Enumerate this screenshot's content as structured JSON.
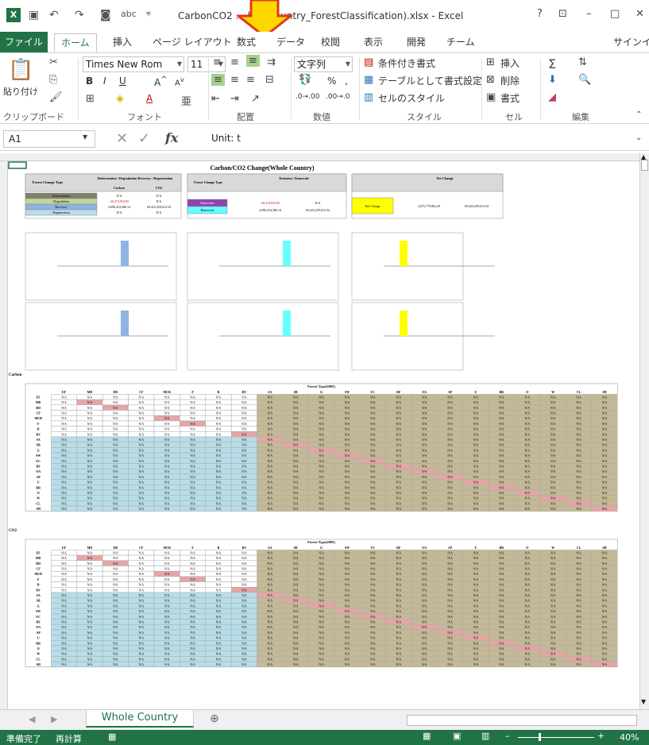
{
  "window": {
    "title": "CarbonCO2 ... holeCountry_ForestClassification).xlsx - Excel",
    "help": "?",
    "minimize": "–",
    "restore": "□",
    "close": "✕"
  },
  "tabs": [
    "ファイル",
    "ホーム",
    "挿入",
    "ページ レイアウト",
    "数式",
    "データ",
    "校閲",
    "表示",
    "開発",
    "チーム"
  ],
  "signin": "サインイ",
  "ribbon": {
    "paste": "貼り付け",
    "font_name": "Times New Rom",
    "font_size": "11",
    "number_format": "文字列",
    "cond_format": "条件付き書式",
    "table_format": "テーブルとして書式設定",
    "cell_style": "セルのスタイル",
    "insert": "挿入",
    "delete": "削除",
    "format": "書式",
    "groups": [
      "クリップボード",
      "フォント",
      "配置",
      "数値",
      "スタイル",
      "セル",
      "編集"
    ]
  },
  "formula": {
    "cell": "A1",
    "fx": "fx",
    "value": "Unit: t"
  },
  "sheet": {
    "title": "Carbon/CO2 Change(Whole Country)",
    "section_carbon": "Carbon",
    "section_co2": "CO2",
    "forest_type_header": "Forest Type(2005)",
    "table1": {
      "hdr_forest_change": "Forest Change Type",
      "hdr_def": "Deforestation / Degradation Recovery / Regeneration",
      "hdr_carbon": "Carbon",
      "hdr_co2": "CO2",
      "rows": [
        "Deforestation",
        "Degradation",
        "Recovery",
        "Regeneration"
      ],
      "carbon_vals": [
        "N/A",
        "-20,474,923.85",
        "2,696,254,386.14",
        "N/A"
      ],
      "co2_vals": [
        "N/A",
        "N/A",
        "69,423,259,613.54",
        "N/A"
      ]
    },
    "table2": {
      "hdr_change_type": "Forest Change Type",
      "hdr_em": "Emission / Removals",
      "emissions": "Emissions",
      "removals": "Removals",
      "em_carbon": "-20,474,923.85",
      "rem_carbon": "2,696,254,386.14",
      "em_co2": "N/A",
      "rem_co2": "69,423,259,613.54"
    },
    "table3": {
      "hdr": "Net Change",
      "net_change": "Net Change",
      "carbon": "2,675,779,862.29",
      "co2": "69,423,259,613.54"
    },
    "types": [
      "EF",
      "MD",
      "DD",
      "CF",
      "MCB",
      "F",
      "B",
      "RV",
      "SA",
      "SR",
      "G",
      "SW",
      "UC",
      "RF",
      "OA",
      "AP",
      "U",
      "BR",
      "O",
      "W",
      "CL",
      "SH"
    ],
    "na": "N/A"
  },
  "sheet_tab": "Whole Country",
  "status": {
    "ready": "準備完了",
    "recalc": "再計算",
    "zoom": "40%"
  },
  "colors": {
    "excel_green": "#217346",
    "na_blue": "#b7dde8",
    "na_tan": "#c4b996",
    "na_red": "#e6a5a5",
    "yellow": "#ffff00",
    "cyan": "#66ffff",
    "bar_blue": "#8eb4e3"
  }
}
